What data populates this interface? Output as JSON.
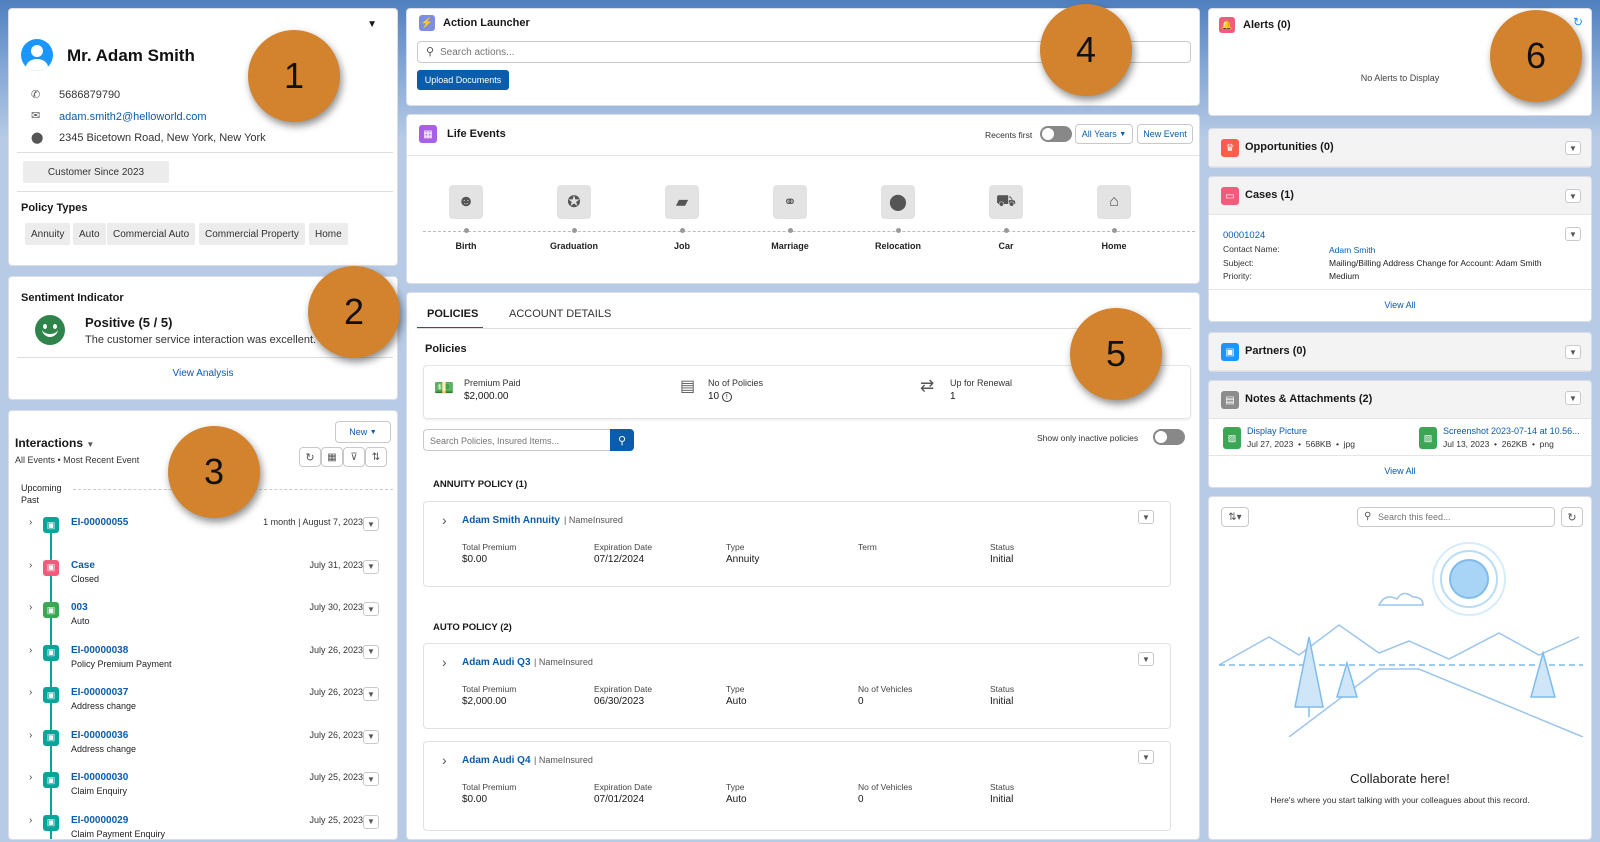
{
  "customer": {
    "name": "Mr. Adam Smith",
    "phone": "5686879790",
    "email": "adam.smith2@helloworld.com",
    "address": "2345 Bicetown Road, New York, New York",
    "since": "Customer Since 2023",
    "policy_types_title": "Policy Types",
    "policy_types": [
      "Annuity",
      "Auto",
      "Commercial Auto",
      "Commercial Property",
      "Home"
    ]
  },
  "sentiment": {
    "title": "Sentiment Indicator",
    "value": "Positive (5 / 5)",
    "text": "The customer service interaction was excellent.",
    "link": "View Analysis"
  },
  "interactions": {
    "title": "Interactions",
    "subtitle": "All Events • Most Recent Event",
    "new_label": "New",
    "upcoming": "Upcoming",
    "past": "Past",
    "items": [
      {
        "name": "EI-00000055",
        "sub": "",
        "date": "1 month | August 7, 2023",
        "color": "#06a59a"
      },
      {
        "name": "Case",
        "sub": "Closed",
        "date": "July 31, 2023",
        "color": "#f25c7c"
      },
      {
        "name": "003",
        "sub": "Auto",
        "date": "July 30, 2023",
        "color": "#3ba755"
      },
      {
        "name": "EI-00000038",
        "sub": "Policy Premium Payment",
        "date": "July 26, 2023",
        "color": "#06a59a"
      },
      {
        "name": "EI-00000037",
        "sub": "Address change",
        "date": "July 26, 2023",
        "color": "#06a59a"
      },
      {
        "name": "EI-00000036",
        "sub": "Address change",
        "date": "July 26, 2023",
        "color": "#06a59a"
      },
      {
        "name": "EI-00000030",
        "sub": "Claim Enquiry",
        "date": "July 25, 2023",
        "color": "#06a59a"
      },
      {
        "name": "EI-00000029",
        "sub": "Claim Payment Enquiry",
        "date": "July 25, 2023",
        "color": "#06a59a"
      }
    ]
  },
  "action_launcher": {
    "title": "Action Launcher",
    "placeholder": "Search actions...",
    "upload": "Upload Documents"
  },
  "life_events": {
    "title": "Life Events",
    "recents": "Recents first",
    "years": "All Years",
    "new_event": "New Event",
    "events": [
      "Birth",
      "Graduation",
      "Job",
      "Marriage",
      "Relocation",
      "Car",
      "Home"
    ]
  },
  "policies": {
    "tab1": "POLICIES",
    "tab2": "ACCOUNT DETAILS",
    "title": "Policies",
    "premium_label": "Premium Paid",
    "premium_value": "$2,000.00",
    "count_label": "No of Policies",
    "count_value": "10",
    "renewal_label": "Up for Renewal",
    "renewal_value": "1",
    "search_placeholder": "Search Policies, Insured Items...",
    "inactive": "Show only inactive policies",
    "annuity_head": "ANNUITY POLICY (1)",
    "auto_head": "AUTO POLICY (2)",
    "name_insured": "| NameInsured",
    "l_total": "Total Premium",
    "l_exp": "Expiration Date",
    "l_type": "Type",
    "l_term": "Term",
    "l_veh": "No of Vehicles",
    "l_status": "Status",
    "annuity": {
      "name": "Adam Smith Annuity",
      "total": "$0.00",
      "exp": "07/12/2024",
      "type": "Annuity",
      "status": "Initial"
    },
    "audi3": {
      "name": "Adam Audi Q3",
      "total": "$2,000.00",
      "exp": "06/30/2023",
      "type": "Auto",
      "veh": "0",
      "status": "Initial"
    },
    "audi4": {
      "name": "Adam Audi Q4",
      "total": "$0.00",
      "exp": "07/01/2024",
      "type": "Auto",
      "veh": "0",
      "status": "Initial"
    }
  },
  "right": {
    "alerts_title": "Alerts (0)",
    "alerts_empty": "No Alerts to Display",
    "opps": "Opportunities (0)",
    "cases": "Cases (1)",
    "case_num": "00001024",
    "l_contact": "Contact Name:",
    "v_contact": "Adam Smith",
    "l_subject": "Subject:",
    "v_subject": "Mailing/Billing Address Change for Account: Adam Smith",
    "l_priority": "Priority:",
    "v_priority": "Medium",
    "view_all": "View All",
    "partners": "Partners (0)",
    "notes": "Notes & Attachments (2)",
    "file1_name": "Display Picture",
    "file1_meta": "Jul 27, 2023  •  568KB  •  jpg",
    "file2_name": "Screenshot 2023-07-14 at 10.56...",
    "file2_meta": "Jul 13, 2023  •  262KB  •  png",
    "feed_placeholder": "Search this feed...",
    "collab_title": "Collaborate here!",
    "collab_text": "Here's where you start talking with your colleagues about this record."
  },
  "callouts": [
    "1",
    "2",
    "3",
    "4",
    "5",
    "6"
  ]
}
